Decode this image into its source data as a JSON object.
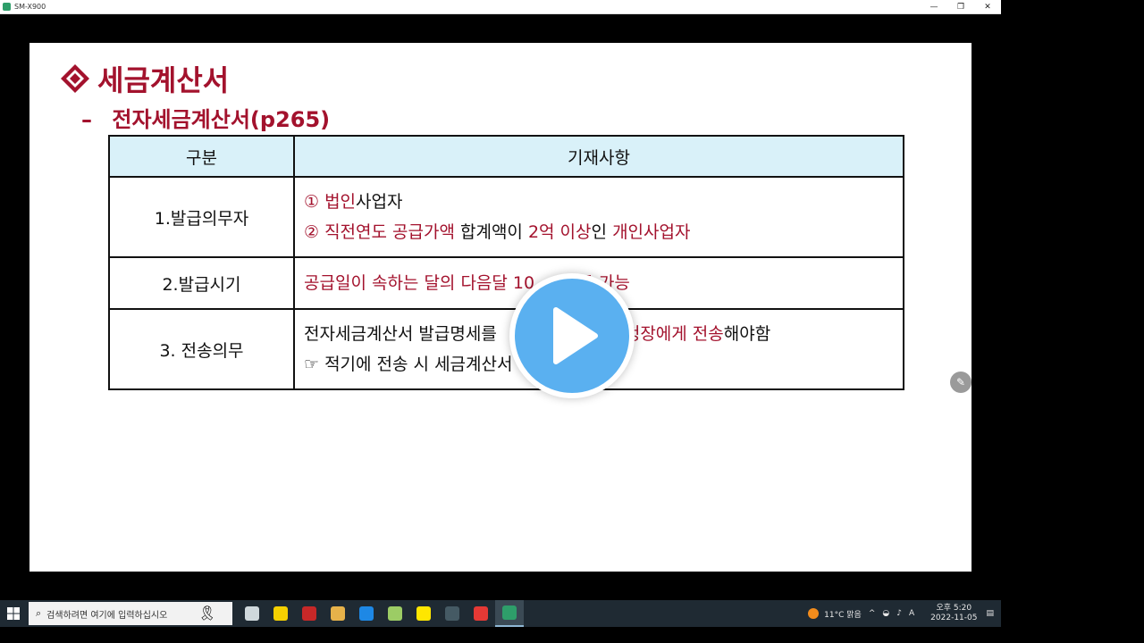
{
  "window": {
    "title": "SM-X900",
    "minimize": "—",
    "restore": "❐",
    "close": "✕"
  },
  "slide": {
    "title": "세금계산서",
    "subtitle_dash": "–",
    "subtitle": "전자세금계산서(p265)",
    "table": {
      "headers": [
        "구분",
        "기재사항"
      ],
      "rows": [
        {
          "category": "1.발급의무자",
          "lines": [
            [
              {
                "t": "① 법인",
                "red": true
              },
              {
                "t": "사업자",
                "red": false
              }
            ],
            [
              {
                "t": "② 직전연도 공급가액",
                "red": true
              },
              {
                "t": " 합계액이 ",
                "red": false
              },
              {
                "t": "2억 이상",
                "red": true
              },
              {
                "t": "인 ",
                "red": false
              },
              {
                "t": "개인사업자",
                "red": true
              }
            ]
          ]
        },
        {
          "category": "2.발급시기",
          "lines": [
            [
              {
                "t": "공급일이 속하는 달의 다음달 10",
                "red": true
              },
              {
                "t": "        ",
                "red": false
              },
              {
                "t": "급 가능",
                "red": true
              }
            ]
          ]
        },
        {
          "category": "3. 전송의무",
          "lines": [
            [
              {
                "t": "전자세금계산서 발급명세를 ",
                "red": false
              },
              {
                "t": "             ",
                "red": false
              },
              {
                "t": "지 국세청장에게 전송",
                "red": true
              },
              {
                "t": "해야함",
                "red": false
              }
            ],
            [
              {
                "t": "☞ 적기에 전송 시 세금계산서",
                "red": false
              },
              {
                "t": "              ",
                "red": false
              },
              {
                "t": "세",
                "red": false
              }
            ]
          ]
        }
      ]
    }
  },
  "taskbar": {
    "search_placeholder": "검색하려면 여기에 입력하십시오",
    "weather": "11°C 맑음",
    "ime": "A",
    "time": "오후 5:20",
    "date": "2022-11-05",
    "icons": [
      {
        "name": "task-view-icon",
        "color": "#cfd8dc"
      },
      {
        "name": "sticky-notes-icon",
        "color": "#f5d000"
      },
      {
        "name": "app-icon-red",
        "color": "#c62828"
      },
      {
        "name": "file-explorer-icon",
        "color": "#e6b24a"
      },
      {
        "name": "edge-icon",
        "color": "#1e88e5"
      },
      {
        "name": "notepad-icon",
        "color": "#9ccc65"
      },
      {
        "name": "kakaotalk-icon",
        "color": "#ffe600"
      },
      {
        "name": "calendar-icon",
        "color": "#455a64"
      },
      {
        "name": "chrome-icon",
        "color": "#e53935"
      },
      {
        "name": "remote-app-icon",
        "color": "#2e9e6a"
      }
    ]
  }
}
